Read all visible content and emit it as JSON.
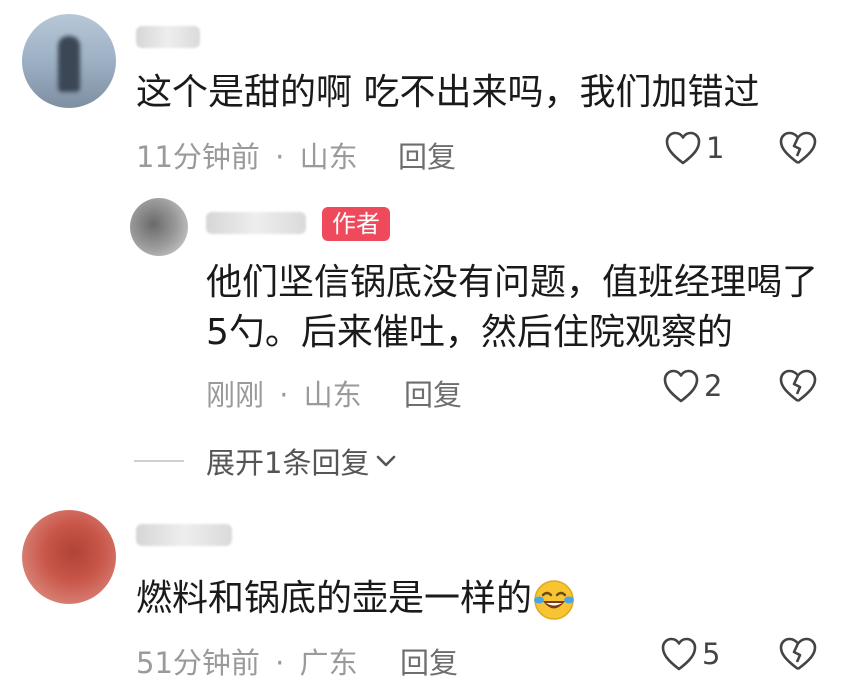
{
  "comments": [
    {
      "text": "这个是甜的啊 吃不出来吗，我们加错过",
      "time": "11分钟前",
      "location": "山东",
      "reply_label": "回复",
      "likes": "1"
    },
    {
      "badge": "作者",
      "text_line1": "他们坚信锅底没有问题，值班经理喝了",
      "text_line2": "5勺。后来催吐，然后住院观察的",
      "time": "刚刚",
      "location": "山东",
      "reply_label": "回复",
      "likes": "2"
    },
    {
      "text": "燃料和锅底的壶是一样的",
      "time": "51分钟前",
      "location": "广东",
      "reply_label": "回复",
      "likes": "5"
    }
  ],
  "expand_replies_label": "展开1条回复",
  "separator": "·",
  "icons": {
    "like": "heart-outline-icon",
    "dislike": "broken-heart-icon",
    "expand": "chevron-down-icon",
    "emoji": "laughing-crying-emoji"
  },
  "colors": {
    "author_badge": "#ee4a5c",
    "meta_text": "#9a9a9a"
  }
}
